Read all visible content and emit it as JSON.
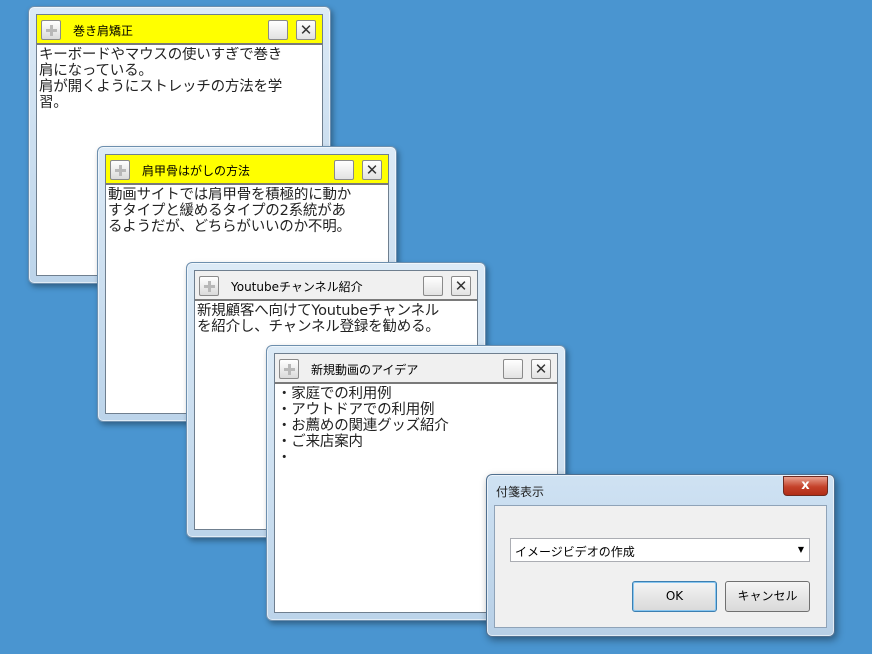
{
  "notes": [
    {
      "title": "巻き肩矯正",
      "body": "キーボードやマウスの使いすぎで巻き\n肩になっている。\n肩が開くようにストレッチの方法を学\n習。",
      "title_color": "#ffff00"
    },
    {
      "title": "肩甲骨はがしの方法",
      "body": "動画サイトでは肩甲骨を積極的に動か\nすタイプと緩めるタイプの2系統があ\nるようだが、どちらがいいのか不明。",
      "title_color": "#ffff00"
    },
    {
      "title": "Youtubeチャンネル紹介",
      "body": "新規顧客へ向けてYoutubeチャンネル\nを紹介し、チャンネル登録を勧める。",
      "title_color": "#f0f0f0"
    },
    {
      "title": "新規動画のアイデア",
      "body": "・家庭での利用例\n・アウトドアでの利用例\n・お薦めの関連グッズ紹介\n・ご来店案内\n・",
      "title_color": "#f0f0f0"
    }
  ],
  "dialog": {
    "title": "付箋表示",
    "close_glyph": "x",
    "combo_value": "イメージビデオの作成",
    "ok_label": "OK",
    "cancel_label": "キャンセル"
  },
  "colors": {
    "desktop": "#4a95d0",
    "title_yellow": "#ffff00",
    "title_gray": "#f0f0f0"
  }
}
